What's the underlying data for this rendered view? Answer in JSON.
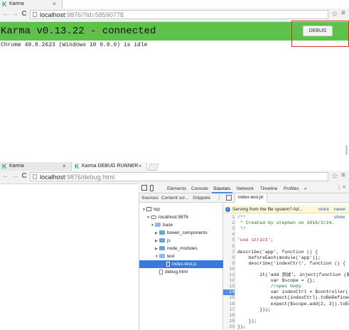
{
  "window_top": {
    "tab": {
      "title": "Karma",
      "close": "×"
    },
    "nav": {
      "back": "←",
      "forward": "→",
      "reload": "C"
    },
    "address": {
      "host": "localhost",
      "rest": ":9876/?id=58590778"
    },
    "star": "☆",
    "menu": "≡",
    "banner": {
      "text": "Karma v0.13.22 - connected",
      "color": "#5ec24a"
    },
    "debug_button": "DEBUG",
    "highlight_color": "#d9302c",
    "status": "Chrome 49.0.2623 (Windows 10 0.0.0) is idle"
  },
  "window_bottom": {
    "tabs": [
      {
        "title": "Karma",
        "close": "×"
      },
      {
        "title": "Karma DEBUG RUNNER",
        "close": "×"
      }
    ],
    "nav": {
      "back": "←",
      "forward": "→",
      "reload": "C"
    },
    "address": {
      "host": "localhost",
      "rest": ":9876/debug.html"
    },
    "star": "☆",
    "menu": "≡"
  },
  "devtools": {
    "tabs": [
      "Elements",
      "Console",
      "Sources",
      "Network",
      "Timeline",
      "Profiles",
      "»"
    ],
    "active_tab": "Sources",
    "close": "×",
    "more": "⋮",
    "navigator_tabs": [
      "Sources",
      "Content scr...",
      "Snippets"
    ],
    "navigator_more": "⋮",
    "tree": [
      {
        "label": "top",
        "type": "frame"
      },
      {
        "label": "localhost:9876",
        "type": "host"
      },
      {
        "label": "base",
        "type": "folder-open"
      },
      {
        "label": "bower_components",
        "type": "folder"
      },
      {
        "label": "js",
        "type": "folder"
      },
      {
        "label": "node_modules",
        "type": "folder"
      },
      {
        "label": "test",
        "type": "folder-open"
      },
      {
        "label": "index-test.js",
        "type": "file",
        "selected": true
      },
      {
        "label": "debug.html",
        "type": "file"
      }
    ],
    "editor_tab": {
      "label": "index-test.js",
      "close": "×"
    },
    "infobar": {
      "icon": "i",
      "text": "Serving from the file system? Ad...",
      "more": "more",
      "never": "never show"
    },
    "breakpoint_line": 14,
    "code_lines": [
      {
        "n": "1",
        "t": "/**"
      },
      {
        "n": "2",
        "t": " * Created by stephen on 2016/3/24."
      },
      {
        "n": "3",
        "t": " */"
      },
      {
        "n": "4",
        "t": ""
      },
      {
        "n": "5",
        "t": "'use strict';"
      },
      {
        "n": "6",
        "t": ""
      },
      {
        "n": "7",
        "t": "describe('app', function () {"
      },
      {
        "n": "8",
        "t": "    beforeEach(module('app'));"
      },
      {
        "n": "9",
        "t": "    describe('indexCtrl', function () {"
      },
      {
        "n": "10",
        "t": ""
      },
      {
        "n": "11",
        "t": "        it('add 测试', inject(function ($co"
      },
      {
        "n": "12",
        "t": "            var $scope = {};"
      },
      {
        "n": "13",
        "t": "            //spec body"
      },
      {
        "n": "14",
        "t": "            var indexCtrl = $controller('i"
      },
      {
        "n": "15",
        "t": "            expect(indexCtrl).toBeDefined("
      },
      {
        "n": "16",
        "t": "            expect($scope.add(2, 3)).toEqu"
      },
      {
        "n": "17",
        "t": "        }));"
      },
      {
        "n": "18",
        "t": ""
      },
      {
        "n": "19",
        "t": "    });"
      },
      {
        "n": "20",
        "t": "});"
      }
    ]
  }
}
